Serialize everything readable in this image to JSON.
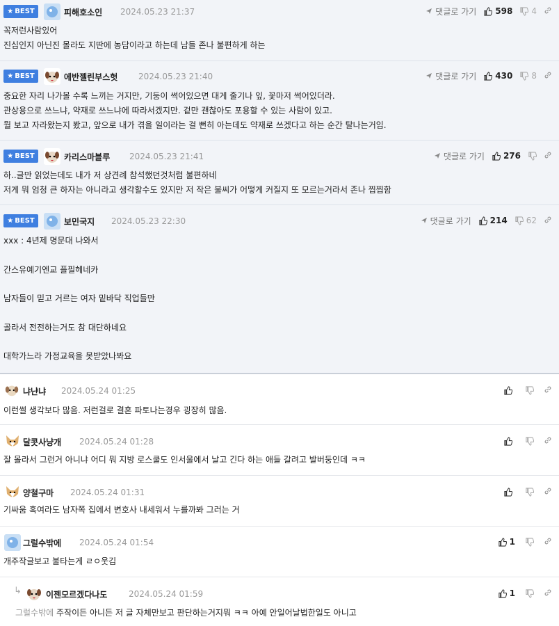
{
  "best_label": "BEST",
  "reply_label": "댓글로 가기",
  "comments": [
    {
      "nick": "피해호소인",
      "date": "2024.05.23 21:37",
      "up": "598",
      "down": "4",
      "lines": [
        "꼭저런사람있어",
        "진심인지 아닌진 몰라도 지딴에 농담이라고 하는데 남들 존나 불편하게 하는"
      ]
    },
    {
      "nick": "에반젤린부스헛",
      "date": "2024.05.23 21:40",
      "up": "430",
      "down": "8",
      "lines": [
        "중요한 자리 나가볼 수록 느끼는 거지만, 기둥이 썩어있으면 대게 줄기나 잎, 꽃마저 썩어있더라.",
        "관상용으로 쓰느냐, 약재로 쓰느냐에 따라서겠지만. 겉만 괜찮아도 포용할 수 있는 사람이 있고.",
        "뭘 보고 자라왔는지 봤고, 앞으로 내가 겪을 일이라는 걸 뻔히 아는데도 약재로 쓰겠다고 하는 순간 탈나는거임."
      ]
    },
    {
      "nick": "카리스마블루",
      "date": "2024.05.23 21:41",
      "up": "276",
      "down": "",
      "lines": [
        "하..글만 읽었는데도 내가 저 상견례 참석했던것처럼 불편하네",
        "저게 뭐 엄청 큰 하자는 아니라고 생각할수도 있지만 저 작은 불씨가 어떻게 커질지 또 모르는거라서 존나 찝찝함"
      ]
    },
    {
      "nick": "보민국지",
      "date": "2024.05.23 22:30",
      "up": "214",
      "down": "62",
      "lines": [
        "xxx : 4년제 명문대 나와서",
        "",
        "간스유예기엔교 플필헤네카",
        "",
        "남자들이 믿고 거르는 여자 밑바닥 직업들만",
        "",
        "골라서 전전하는거도 참 대단하네요",
        "",
        "대학가느라 가정교육을 못받았나봐요"
      ]
    },
    {
      "nick": "냐냔냐",
      "date": "2024.05.24 01:25",
      "up": "",
      "down": "",
      "lines": [
        "이런썰 생각보다 많음. 저런걸로 결혼 파토나는경우 굉장히 많음."
      ]
    },
    {
      "nick": "달콧사냥개",
      "date": "2024.05.24 01:28",
      "up": "",
      "down": "",
      "lines": [
        "잘 몰라서 그런거 아니냐 어디 뭐 지방 로스쿨도 인서울에서 날고 긴다 하는 애들 갈려고 발버둥인데 ㅋㅋ"
      ]
    },
    {
      "nick": "양철구마",
      "date": "2024.05.24 01:31",
      "up": "",
      "down": "",
      "lines": [
        "기싸움 혹여라도 남자쪽 집에서 변호사 내세워서 누를까봐 그러는 거"
      ]
    },
    {
      "nick": "그럴수밖에",
      "date": "2024.05.24 01:54",
      "up": "1",
      "down": "",
      "lines": [
        "개주작글보고 불타는게 ㄹㅇ웃김"
      ]
    },
    {
      "nick": "이젠모르겠다나도",
      "date": "2024.05.24 01:59",
      "up": "1",
      "down": "",
      "reply_to": "그럴수밖에",
      "lines": [
        "주작이든 아니든 저 글 자체만보고 판단하는거지뭐 ㅋㅋ 아예 안일어날법한일도 아니고"
      ]
    }
  ],
  "colors": {
    "best_badge": "#3f7fe0",
    "best_bg": "#f2f4f8"
  }
}
